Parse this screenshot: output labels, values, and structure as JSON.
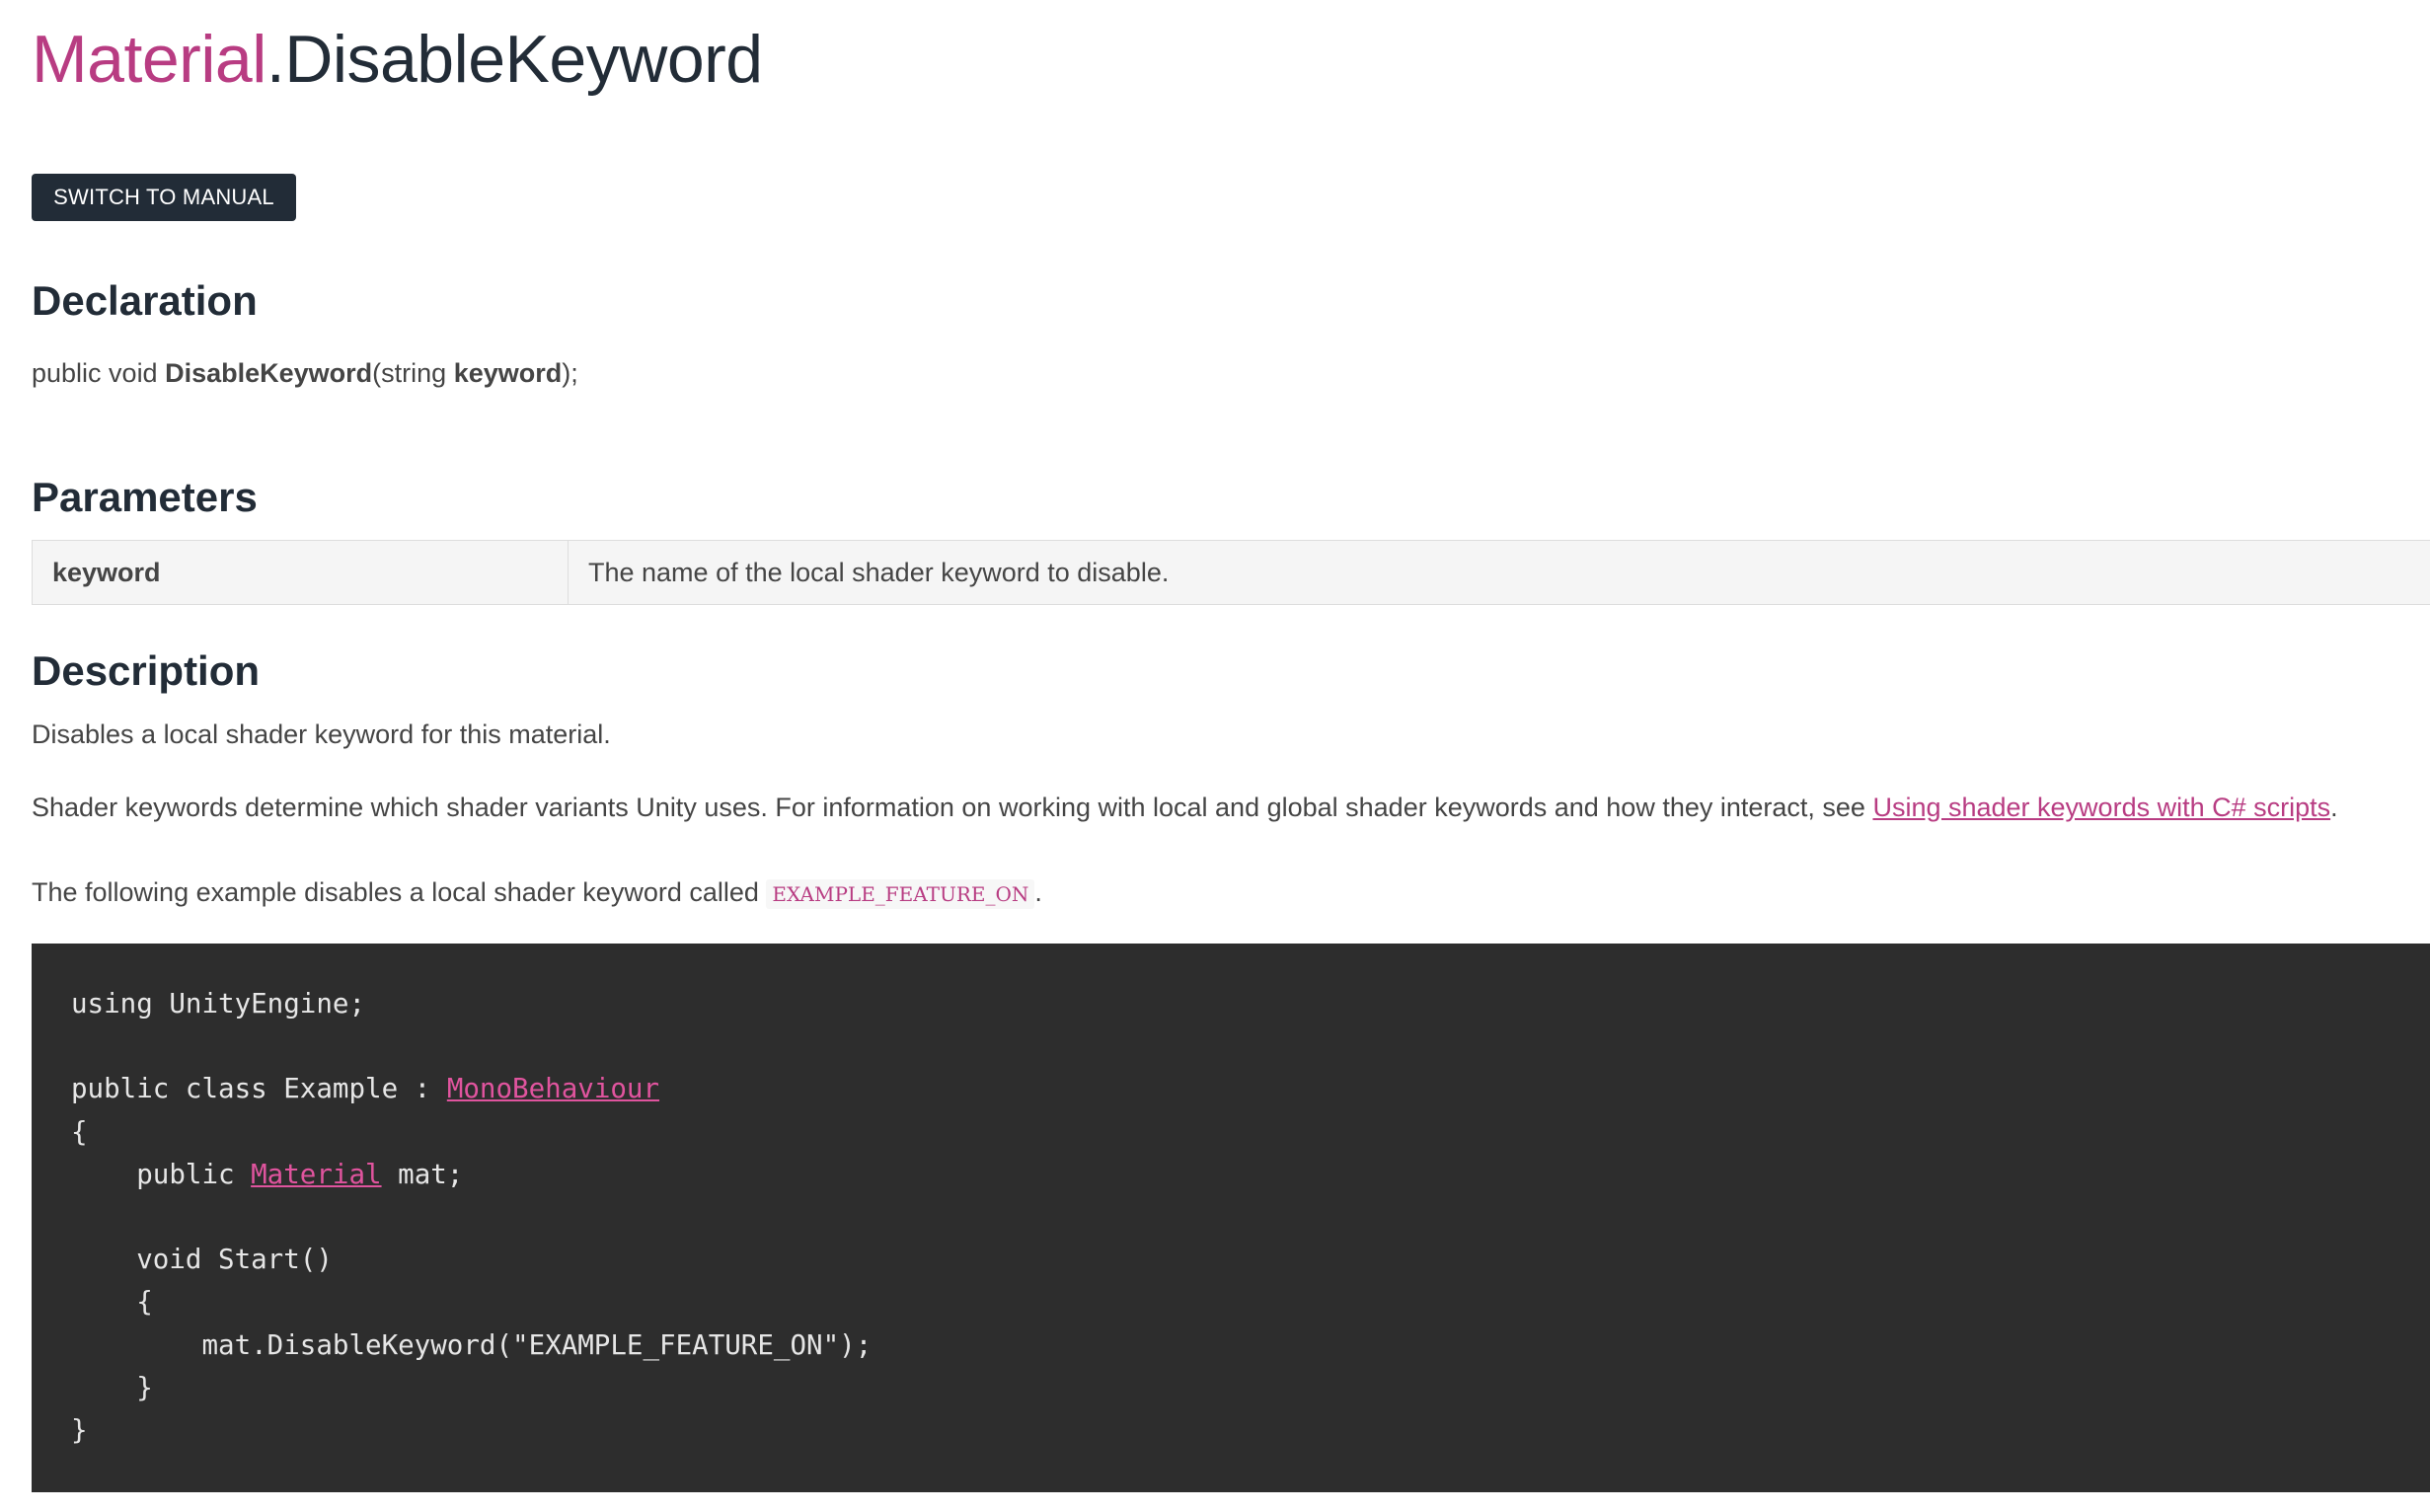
{
  "title": {
    "class_name": "Material",
    "separator": ".",
    "member_name": "DisableKeyword"
  },
  "toolbar": {
    "switch_label": "SWITCH TO MANUAL"
  },
  "declaration": {
    "heading": "Declaration",
    "prefix": "public void ",
    "method": "DisableKeyword",
    "open": "(string ",
    "param": "keyword",
    "close": ");"
  },
  "parameters": {
    "heading": "Parameters",
    "rows": [
      {
        "name": "keyword",
        "description": "The name of the local shader keyword to disable."
      }
    ]
  },
  "description": {
    "heading": "Description",
    "p1": "Disables a local shader keyword for this material.",
    "p2_text": "Shader keywords determine which shader variants Unity uses. For information on working with local and global shader keywords and how they interact, see ",
    "p2_link": "Using shader keywords with C# scripts",
    "p2_end": ".",
    "p3_text": "The following example disables a local shader keyword called ",
    "p3_code": "EXAMPLE_FEATURE_ON",
    "p3_end": "."
  },
  "code": {
    "line1": "using UnityEngine;",
    "line3_a": "public class Example : ",
    "line3_link": "MonoBehaviour",
    "line4": "{",
    "line5_a": "    public ",
    "line5_link": "Material",
    "line5_b": " mat;",
    "line7": "    void Start()",
    "line8": "    {",
    "line9": "        mat.DisableKeyword(\"EXAMPLE_FEATURE_ON\");",
    "line10": "    }",
    "line11": "}"
  }
}
